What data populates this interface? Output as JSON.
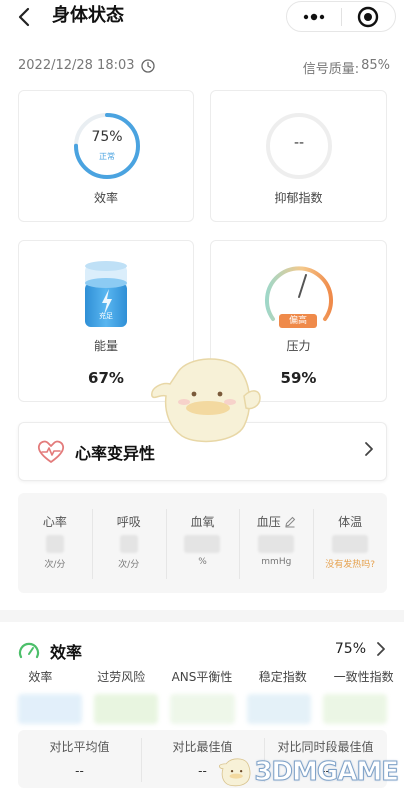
{
  "header": {
    "title": "身体状态",
    "back_icon": "chevron-left-icon",
    "more_icon": "more-dots-icon",
    "target_icon": "target-icon"
  },
  "status": {
    "datetime": "2022/12/28 18:03",
    "clock_icon": "clock-icon",
    "signal_label": "信号质量:",
    "signal_value": "85%"
  },
  "cards": {
    "efficiency": {
      "value": "75%",
      "percent": 75,
      "status": "正常",
      "label": "效率",
      "color": "#4aa3e0"
    },
    "depression": {
      "value": "--",
      "label": "抑郁指数"
    },
    "energy": {
      "label": "能量",
      "value": "67%",
      "battery_tag": "充足",
      "color": "#3d9de0"
    },
    "stress": {
      "label": "压力",
      "value": "59%",
      "badge": "偏高",
      "badge_color": "#ef8a4a"
    }
  },
  "hrv": {
    "title": "心率变异性",
    "icon": "heart-pulse-icon"
  },
  "vitals": [
    {
      "name": "心率",
      "unit": "次/分"
    },
    {
      "name": "呼吸",
      "unit": "次/分"
    },
    {
      "name": "血氧",
      "unit": "%"
    },
    {
      "name": "血压",
      "unit": "mmHg",
      "icon": "edit-pencil-icon"
    },
    {
      "name": "体温",
      "unit": "没有发热吗?"
    }
  ],
  "efficiency_panel": {
    "title": "效率",
    "value": "75%",
    "icon": "gauge-icon",
    "tabs": [
      "效率",
      "过劳风险",
      "ANS平衡性",
      "稳定指数",
      "一致性指数"
    ],
    "compare": [
      {
        "title": "对比平均值",
        "value": "--"
      },
      {
        "title": "对比最佳值",
        "value": "--"
      },
      {
        "title": "对比同时段最佳值",
        "value": "--"
      }
    ]
  },
  "watermark": {
    "text": "3DMGAME"
  }
}
